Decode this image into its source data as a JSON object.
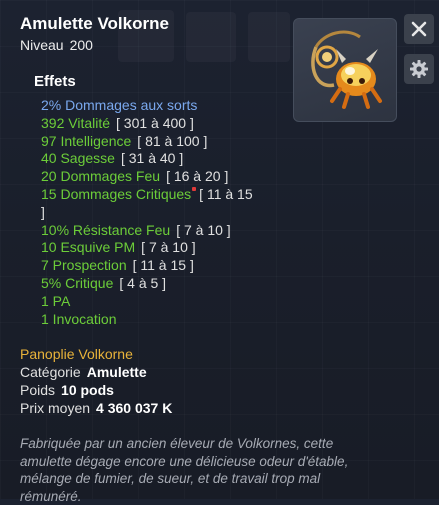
{
  "item": {
    "name": "Amulette Volkorne",
    "level_label": "Niveau",
    "level_value": "200"
  },
  "effects": {
    "title": "Effets",
    "list": [
      {
        "name": "2% Dommages aux sorts",
        "range": "",
        "color": "#7aa8ee"
      },
      {
        "name": "392 Vitalité",
        "range": "[ 301 à 400 ]"
      },
      {
        "name": "97 Intelligence",
        "range": "[ 81 à 100 ]"
      },
      {
        "name": "40 Sagesse",
        "range": "[ 31 à 40 ]"
      },
      {
        "name": "20 Dommages Feu",
        "range": "[ 16 à 20 ]"
      },
      {
        "name": "15 Dommages Critiques",
        "range": "[ 11 à 15",
        "range_cont": "]"
      },
      {
        "name": "10% Résistance Feu",
        "range": "[ 7 à 10 ]"
      },
      {
        "name": "10 Esquive PM",
        "range": "[ 7 à 10 ]"
      },
      {
        "name": "7 Prospection",
        "range": "[ 11 à 15 ]"
      },
      {
        "name": "5% Critique",
        "range": "[ 4 à 5 ]"
      },
      {
        "name": "1 PA",
        "range": ""
      },
      {
        "name": "1 Invocation",
        "range": ""
      }
    ]
  },
  "panoplie": "Panoplie Volkorne",
  "details": {
    "category_label": "Catégorie",
    "category_value": "Amulette",
    "weight_label": "Poids",
    "weight_value": "10 pods",
    "price_label": "Prix moyen",
    "price_value": "4 360 037 K"
  },
  "description": "Fabriquée par un ancien éleveur de Volkornes, cette amulette dégage encore une délicieuse odeur d'étable, mélange de fumier, de sueur, et de travail trop mal rémunéré.",
  "icons": {
    "item": "amulet-volkorne-icon",
    "close": "close-icon",
    "settings": "gear-icon"
  },
  "colors": {
    "effect_green": "#6ccd39",
    "effect_blue": "#7aa8ee",
    "panoplie_gold": "#e8b33a"
  }
}
